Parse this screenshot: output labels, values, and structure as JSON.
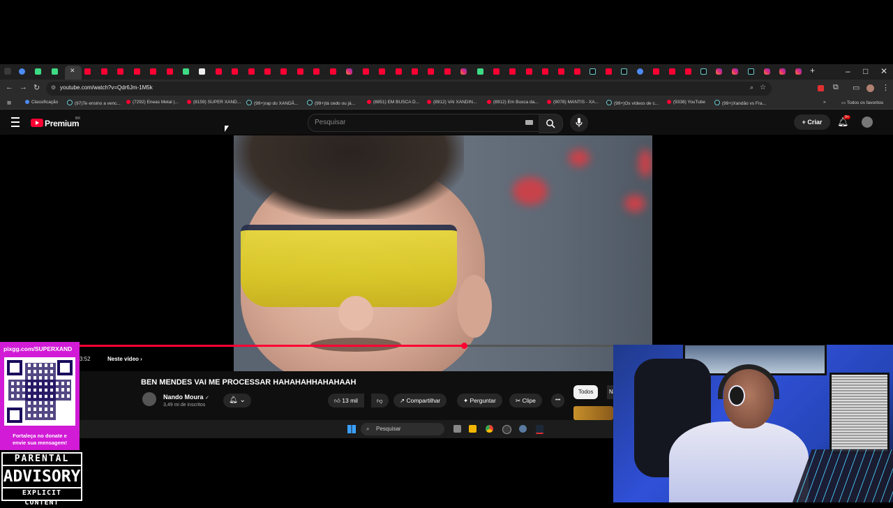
{
  "browser": {
    "url": "youtube.com/watch?v=Qdr6Jm-1M5k",
    "window_controls": [
      "–",
      "□",
      "✕"
    ],
    "bookmarks": [
      "Classificação",
      "(97)Te ensino a venc...",
      "(7292) Eneas Metal |...",
      "(8159) SUPER XAND...",
      "(99+)rap do XANDÃ...",
      "(99+)tá cedo ou já...",
      "(8851) EM BUSCA D...",
      "(8912) VAI XANDIN...",
      "(8912) Em Busca da...",
      "(9078) MANTIS - XA...",
      "(99+)Os vídeos de c...",
      "(9338) YouTube",
      "(99+)Xandão vs Fra..."
    ],
    "all_bookmarks": "Todos os favoritos"
  },
  "youtube": {
    "logo_text": "Premium",
    "region": "BR",
    "search_placeholder": "Pesquisar",
    "create_label": "Criar",
    "notif_count": "9+"
  },
  "player": {
    "progress_fraction": 0.756,
    "time": "3:52",
    "in_video": "Neste vídeo"
  },
  "video_info": {
    "title": "BEN MENDES VAI ME PROCESSAR HAHAHAHHAHAHAAH",
    "channel": "Nando Moura",
    "verified": "✓",
    "subscribers": "3,49 mi de inscritos",
    "likes": "13 mil",
    "share": "Compartilhar",
    "ask": "Perguntar",
    "clip": "Clipe",
    "more": "•••",
    "chip_all": "Todos",
    "chip_next": "N"
  },
  "taskbar": {
    "search": "Pesquisar"
  },
  "overlay": {
    "pix_url": "pixgg.com/SUPERXAND",
    "pix_message_1": "Fortaleça no donate e",
    "pix_message_2": "envie sua mensagem!",
    "advisory_1": "PARENTAL",
    "advisory_2": "ADVISORY",
    "advisory_3": "EXPLICIT CONTENT"
  },
  "colors": {
    "accent_red": "#ff0033",
    "pix_magenta": "#d11bd6"
  }
}
